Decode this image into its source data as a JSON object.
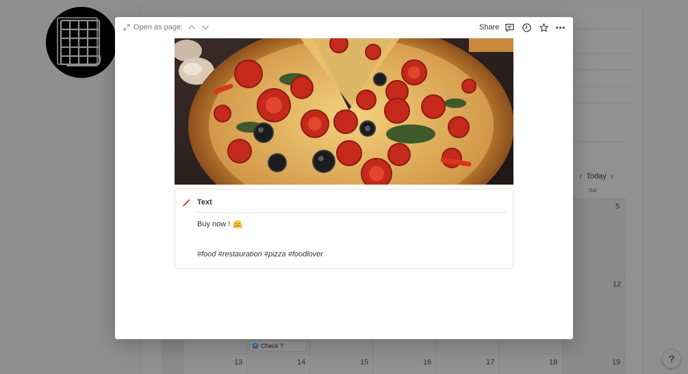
{
  "background": {
    "calendar": {
      "today_label": "Today",
      "weekday_sat": "Sat",
      "day_numbers_right": [
        "5",
        "12",
        "19"
      ],
      "bottom_row_days": [
        "13",
        "14",
        "15",
        "16",
        "17",
        "18"
      ],
      "event_label": "Check ?"
    },
    "help_label": "?"
  },
  "modal": {
    "open_as_page": "Open as page",
    "share": "Share",
    "icons": [
      "expand-icon",
      "chevron-up-icon",
      "chevron-down-icon",
      "comment-icon",
      "clock-icon",
      "star-icon",
      "more-icon"
    ],
    "property": {
      "name": "Text",
      "icon": "pencil-icon",
      "line1": "Buy now !",
      "line1_emoji": "hugging-face-emoji",
      "line2": "#food #restauration #pizza #foodlover"
    }
  },
  "colors": {
    "overlay": "#8f8f8f",
    "modal_bg": "#ffffff",
    "text": "#37352f",
    "muted": "#787774",
    "border": "#e3e2df"
  }
}
